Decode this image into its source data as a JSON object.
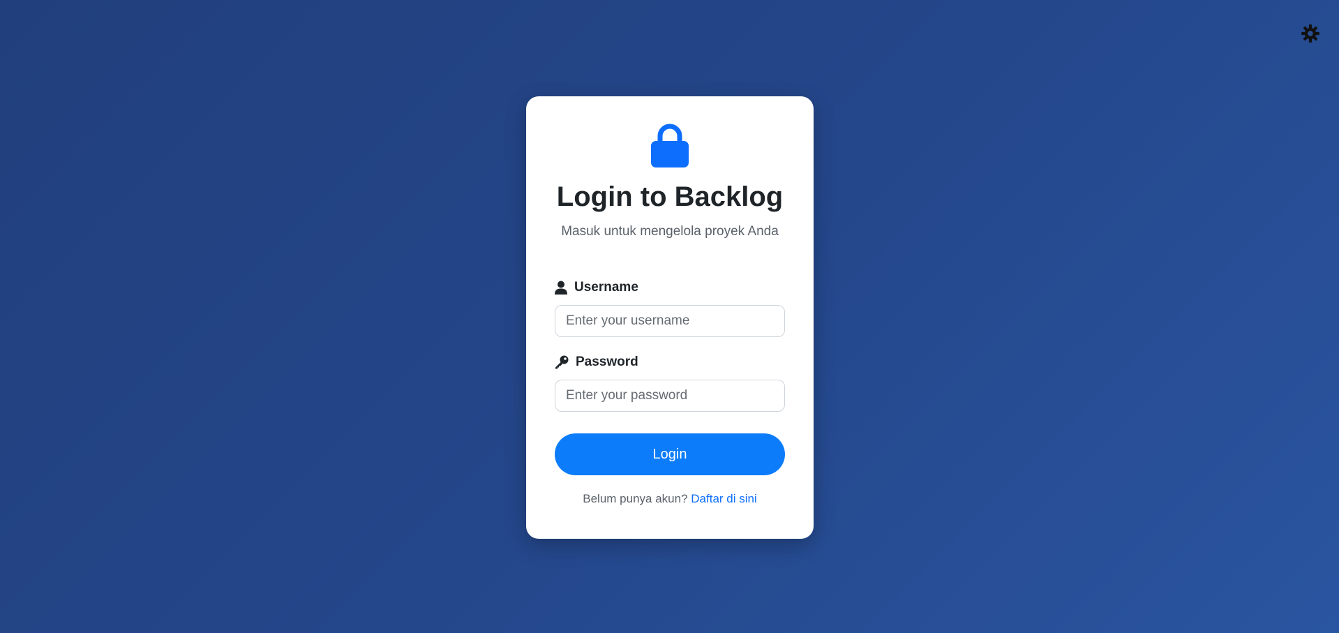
{
  "theme_toggle": {
    "icon": "gear-icon"
  },
  "login_card": {
    "icon": "lock-icon",
    "title": "Login to Backlog",
    "subtitle": "Masuk untuk mengelola proyek Anda",
    "username": {
      "icon": "user-icon",
      "label": "Username",
      "value": "",
      "placeholder": "Enter your username"
    },
    "password": {
      "icon": "key-icon",
      "label": "Password",
      "value": "",
      "placeholder": "Enter your password"
    },
    "login_button": "Login",
    "register_prompt": "Belum punya akun?",
    "register_link": "Daftar di sini"
  },
  "colors": {
    "background_start": "#213f7c",
    "background_end": "#2a55a0",
    "accent": "#0d7cfb",
    "link": "#0d6efd",
    "title_text": "#1f2429",
    "muted_text": "#5a6169"
  }
}
